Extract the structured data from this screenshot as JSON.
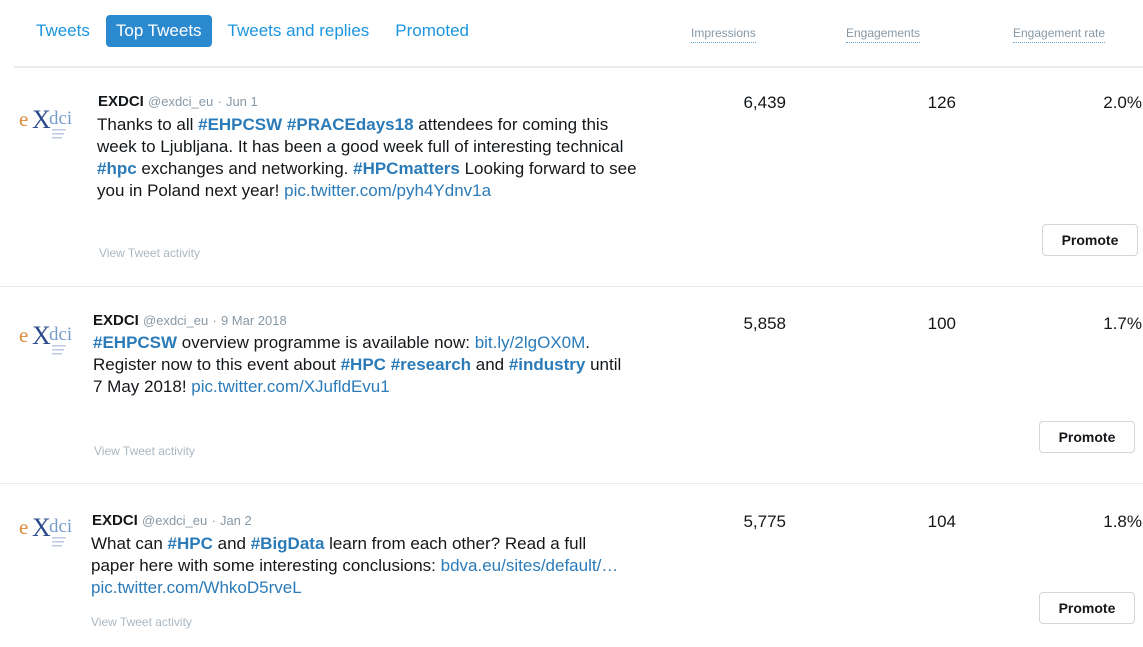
{
  "tabs": [
    {
      "label": "Tweets",
      "active": false
    },
    {
      "label": "Top Tweets",
      "active": true
    },
    {
      "label": "Tweets and replies",
      "active": false
    },
    {
      "label": "Promoted",
      "active": false
    }
  ],
  "columns": {
    "impressions": "Impressions",
    "engagements": "Engagements",
    "engagement_rate": "Engagement rate"
  },
  "colors": {
    "accent": "#1b95e0",
    "active_tab_bg": "#2b89d0",
    "hashtag": "#2b7bb9",
    "muted": "#8899a6"
  },
  "tweets": [
    {
      "logo_icon": "exdci-logo-icon",
      "name": "EXDCI",
      "handle": "@exdci_eu",
      "separator": "·",
      "date": "Jun 1",
      "segments": [
        {
          "t": "Thanks to all "
        },
        {
          "t": "#EHPCSW",
          "k": "tag"
        },
        {
          "t": " "
        },
        {
          "t": "#PRACEdays18",
          "k": "tag"
        },
        {
          "t": " attendees for coming this week to Ljubljana. It has been a good week full of interesting technical "
        },
        {
          "t": "#hpc",
          "k": "tag"
        },
        {
          "t": " exchanges and networking. "
        },
        {
          "t": "#HPCmatters",
          "k": "tag"
        },
        {
          "t": " Looking forward to see you in Poland next year! "
        },
        {
          "t": "pic.twitter.com/pyh4Ydnv1a",
          "k": "link"
        }
      ],
      "activity_label": "View Tweet activity",
      "impressions": "6,439",
      "engagements": "126",
      "engagement_rate": "2.0%",
      "promote_label": "Promote"
    },
    {
      "logo_icon": "exdci-logo-icon",
      "name": "EXDCI",
      "handle": "@exdci_eu",
      "separator": "·",
      "date": "9 Mar 2018",
      "segments": [
        {
          "t": "#EHPCSW",
          "k": "tag"
        },
        {
          "t": " overview programme is available now: "
        },
        {
          "t": "bit.ly/2lgOX0M",
          "k": "link"
        },
        {
          "t": ". Register now to this event about "
        },
        {
          "t": "#HPC",
          "k": "tag"
        },
        {
          "t": " "
        },
        {
          "t": "#research",
          "k": "tag"
        },
        {
          "t": " and "
        },
        {
          "t": "#industry",
          "k": "tag"
        },
        {
          "t": " until 7 May 2018! "
        },
        {
          "t": "pic.twitter.com/XJufldEvu1",
          "k": "link"
        }
      ],
      "activity_label": "View Tweet activity",
      "impressions": "5,858",
      "engagements": "100",
      "engagement_rate": "1.7%",
      "promote_label": "Promote"
    },
    {
      "logo_icon": "exdci-logo-icon",
      "name": "EXDCI",
      "handle": "@exdci_eu",
      "separator": "·",
      "date": "Jan 2",
      "segments": [
        {
          "t": "What can "
        },
        {
          "t": "#HPC",
          "k": "tag"
        },
        {
          "t": " and "
        },
        {
          "t": "#BigData",
          "k": "tag"
        },
        {
          "t": " learn from each other? Read a full paper here with some interesting conclusions: "
        },
        {
          "t": "bdva.eu/sites/default/…",
          "k": "link"
        },
        {
          "t": " "
        },
        {
          "t": "pic.twitter.com/WhkoD5rveL",
          "k": "link"
        }
      ],
      "activity_label": "View Tweet activity",
      "impressions": "5,775",
      "engagements": "104",
      "engagement_rate": "1.8%",
      "promote_label": "Promote"
    }
  ]
}
